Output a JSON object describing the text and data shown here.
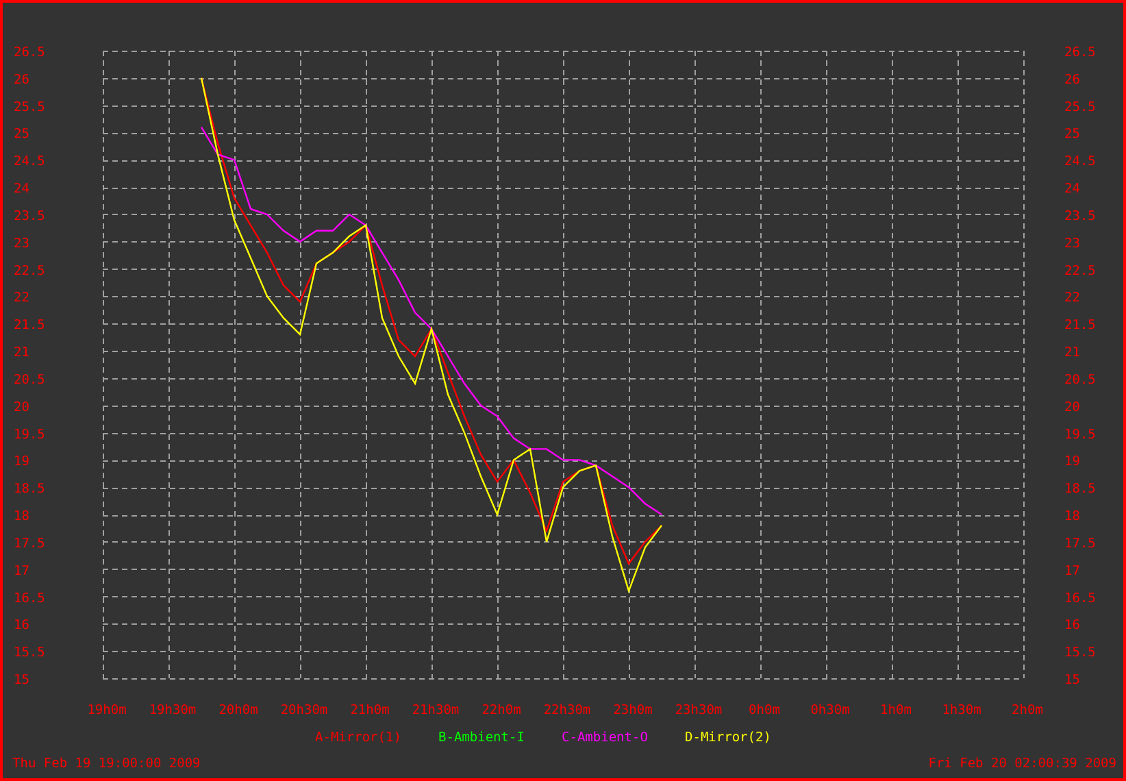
{
  "chart_data": {
    "type": "line",
    "grid": true,
    "ylim": [
      15,
      26.5
    ],
    "categories": [
      "19h0m",
      null,
      null,
      null,
      "19h30m",
      null,
      null,
      null,
      "20h0m",
      null,
      null,
      null,
      "20h30m",
      null,
      null,
      null,
      "21h0m",
      null,
      null,
      null,
      "21h30m",
      null,
      null,
      null,
      "22h0m",
      null,
      null,
      null,
      "22h30m",
      null,
      null,
      null,
      "23h0m",
      null,
      null,
      null,
      "23h30m",
      null,
      null,
      null,
      "0h0m",
      null,
      null,
      null,
      "0h30m",
      null,
      null,
      null,
      "1h0m",
      null,
      null,
      null,
      "1h30m",
      null,
      null,
      null,
      "2h0m"
    ],
    "yticks": [
      {
        "value": 15,
        "label": "15"
      },
      {
        "value": 15.5,
        "label": "15.5"
      },
      {
        "value": 16,
        "label": "16"
      },
      {
        "value": 16.5,
        "label": "16.5"
      },
      {
        "value": 17,
        "label": "17"
      },
      {
        "value": 17.5,
        "label": "17.5"
      },
      {
        "value": 18,
        "label": "18"
      },
      {
        "value": 18.5,
        "label": "18.5"
      },
      {
        "value": 19,
        "label": "19"
      },
      {
        "value": 19.5,
        "label": "19.5"
      },
      {
        "value": 20,
        "label": "20"
      },
      {
        "value": 20.5,
        "label": "20.5"
      },
      {
        "value": 21,
        "label": "21"
      },
      {
        "value": 21.5,
        "label": "21.5"
      },
      {
        "value": 22,
        "label": "22"
      },
      {
        "value": 22.5,
        "label": "22.5"
      },
      {
        "value": 23,
        "label": "23"
      },
      {
        "value": 23.5,
        "label": "23.5"
      },
      {
        "value": 24,
        "label": "24"
      },
      {
        "value": 24.5,
        "label": "24.5"
      },
      {
        "value": 25,
        "label": "25"
      },
      {
        "value": 25.5,
        "label": "25.5"
      },
      {
        "value": 26,
        "label": "26"
      },
      {
        "value": 26.5,
        "label": "26.5"
      }
    ],
    "series": [
      {
        "name": "A-Mirror(1)",
        "color": "#ff0000",
        "values": [
          null,
          null,
          null,
          null,
          null,
          null,
          26.0,
          24.8,
          23.8,
          23.3,
          22.8,
          22.2,
          21.9,
          22.6,
          22.8,
          23.0,
          23.3,
          22.2,
          21.2,
          20.9,
          21.4,
          20.6,
          19.8,
          19.1,
          18.6,
          19.0,
          18.4,
          17.7,
          18.6,
          18.8,
          18.9,
          17.8,
          17.1,
          17.5,
          17.8,
          null,
          null,
          null,
          null,
          null,
          null,
          null,
          null,
          null,
          null,
          null,
          null,
          null,
          null,
          null,
          null,
          null,
          null,
          null,
          null,
          null,
          null
        ]
      },
      {
        "name": "B-Ambient-I",
        "color": "#00ff00",
        "values": [
          null,
          null,
          null,
          null,
          null,
          null,
          null,
          null,
          null,
          null,
          null,
          null,
          null,
          null,
          null,
          null,
          null,
          null,
          null,
          null,
          null,
          null,
          null,
          null,
          null,
          null,
          null,
          null,
          null,
          null,
          null,
          null,
          null,
          null,
          null,
          null,
          null,
          null,
          null,
          null,
          null,
          null,
          null,
          null,
          null,
          null,
          null,
          null,
          null,
          null,
          null,
          null,
          null,
          null,
          null,
          null,
          null
        ]
      },
      {
        "name": "C-Ambient-O",
        "color": "#ff00ff",
        "values": [
          null,
          null,
          null,
          null,
          null,
          null,
          25.1,
          24.6,
          24.5,
          23.6,
          23.5,
          23.2,
          23.0,
          23.2,
          23.2,
          23.5,
          23.3,
          22.8,
          22.3,
          21.7,
          21.4,
          20.9,
          20.4,
          20.0,
          19.8,
          19.4,
          19.2,
          19.2,
          19.0,
          19.0,
          18.9,
          18.7,
          18.5,
          18.2,
          18.0,
          null,
          null,
          null,
          null,
          null,
          null,
          null,
          null,
          null,
          null,
          null,
          null,
          null,
          null,
          null,
          null,
          null,
          null,
          null,
          null,
          null,
          null
        ]
      },
      {
        "name": "D-Mirror(2)",
        "color": "#ffff00",
        "values": [
          null,
          null,
          null,
          null,
          null,
          null,
          26.0,
          24.6,
          23.4,
          22.7,
          22.0,
          21.6,
          21.3,
          22.6,
          22.8,
          23.1,
          23.3,
          21.6,
          20.9,
          20.4,
          21.4,
          20.2,
          19.5,
          18.7,
          18.0,
          19.0,
          19.2,
          17.5,
          18.5,
          18.8,
          18.9,
          17.6,
          16.6,
          17.4,
          17.8,
          null,
          null,
          null,
          null,
          null,
          null,
          null,
          null,
          null,
          null,
          null,
          null,
          null,
          null,
          null,
          null,
          null,
          null,
          null,
          null,
          null,
          null
        ]
      }
    ]
  },
  "right_axis_labels": [
    "26.5",
    "26",
    "25.5",
    "25",
    "24.5",
    "24",
    "23.5",
    "23",
    "22.5",
    "22",
    "21.5",
    "21",
    "20.5",
    "20",
    "19.5",
    "19",
    "18.5",
    "18",
    "17.5",
    "17",
    "16.5",
    "16",
    "15.5",
    "15"
  ],
  "start_time": "Thu Feb 19 19:00:00 2009",
  "end_time": "Fri Feb 20 02:00:39 2009"
}
